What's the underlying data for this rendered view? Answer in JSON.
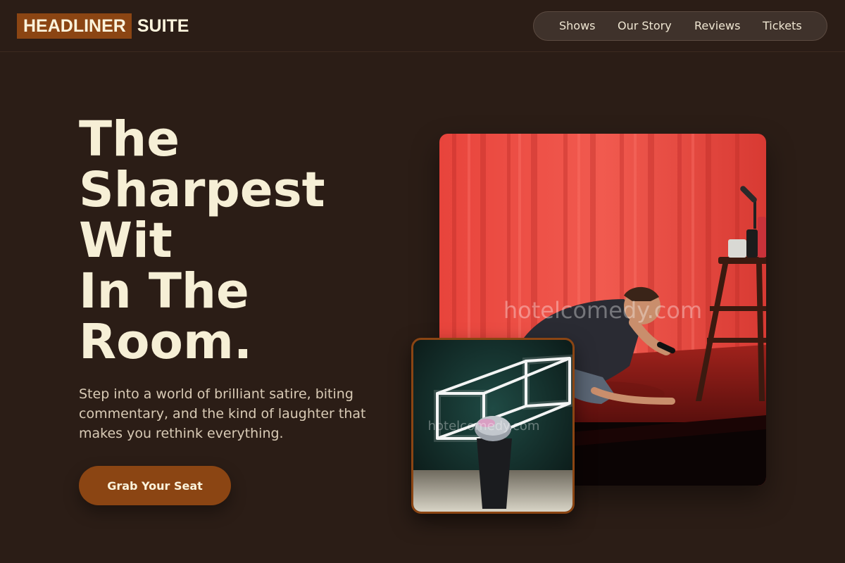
{
  "brand": {
    "logo_highlight": "HEADLINER",
    "logo_rest": "SUITE"
  },
  "nav": {
    "items": [
      "Shows",
      "Our Story",
      "Reviews",
      "Tickets"
    ]
  },
  "hero": {
    "title_lines": [
      "The",
      "Sharpest",
      "Wit",
      "In The",
      "Room."
    ],
    "subtitle": "Step into a world of brilliant satire, biting commentary, and the kind of laughter that makes you rethink everything.",
    "cta_label": "Grab Your Seat"
  },
  "images": {
    "main": {
      "watermark": "hotelcomedy.com"
    },
    "small": {
      "watermark": "hotelcomedy.com"
    }
  },
  "colors": {
    "background": "#2b1d16",
    "accent": "#8b4513",
    "text": "#f6efd6",
    "muted_text": "#d9cbb6",
    "nav_pill": "#3f322b"
  }
}
